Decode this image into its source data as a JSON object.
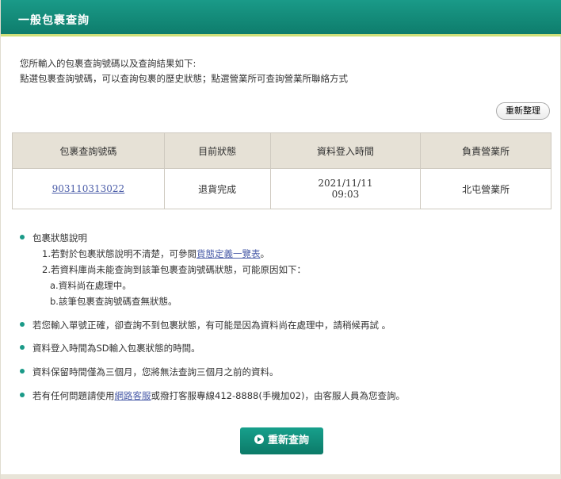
{
  "header": {
    "title": "一般包裹查詢"
  },
  "intro": {
    "line1": "您所輸入的包裹查詢號碼以及查詢結果如下:",
    "line2": "點選包裹查詢號碼，可以查詢包裹的歷史狀態；點選營業所可查詢營業所聯絡方式"
  },
  "toolbar": {
    "reset_label": "重新整理"
  },
  "table": {
    "headers": [
      "包裹查詢號碼",
      "目前狀態",
      "資料登入時間",
      "負責營業所"
    ],
    "rows": [
      {
        "tracking_no": "903110313022",
        "status": "退貨完成",
        "date": "2021/11/11",
        "time": "09:03",
        "office": "北屯營業所"
      }
    ]
  },
  "notes": {
    "status_desc": {
      "title": "包裹狀態說明",
      "item1_prefix": "1.若對於包裹狀態說明不清楚，可參閱",
      "item1_link": "貨態定義一覽表",
      "item1_suffix": "。",
      "item2": "2.若資料庫尚未能查詢到該筆包裹查詢號碼狀態，可能原因如下：",
      "reason_a": "a.資料尚在處理中。",
      "reason_b": "b.該筆包裹查詢號碼查無狀態。"
    },
    "note2": "若您輸入單號正確，卻查詢不到包裹狀態，有可能是因為資料尚在處理中，請稍候再試 。",
    "note3": "資料登入時間為SD輸入包裹狀態的時間。",
    "note4": "資料保留時間僅為三個月，您將無法查詢三個月之前的資料。",
    "note5_prefix": "若有任何問題請使用",
    "note5_link": "網路客服",
    "note5_suffix": "或撥打客服專線412-8888(手機加02)，由客服人員為您查詢。"
  },
  "actions": {
    "requery_label": "重新查詢"
  },
  "colors": {
    "header_bg": "#1a9a88",
    "header_underline": "#cfe07a",
    "table_header_bg": "#e6e1d6",
    "link": "#4a5ca8",
    "button_bg": "#0e7d6c"
  }
}
